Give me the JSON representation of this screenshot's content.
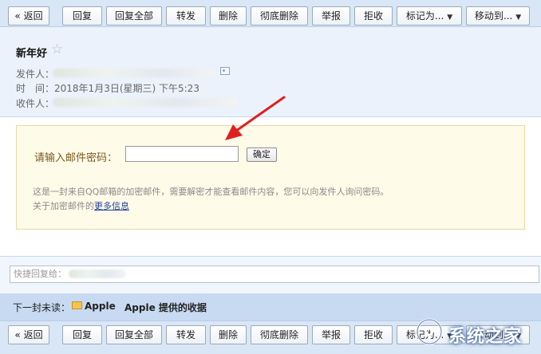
{
  "toolbar": {
    "back": "« 返回",
    "reply": "回复",
    "reply_all": "回复全部",
    "forward": "转发",
    "delete": "删除",
    "delete_permanent": "彻底删除",
    "report": "举报",
    "reject": "拒收",
    "mark_as": "标记为...",
    "move_to": "移动到..."
  },
  "email": {
    "subject": "新年好",
    "from_label": "发件人：",
    "time_label": "时　间：",
    "time_value": "2018年1月3日(星期三) 下午5:23",
    "to_label": "收件人："
  },
  "password_panel": {
    "prompt": "请输入邮件密码：",
    "confirm_button": "确定",
    "hint_line1": "这是一封来自QQ邮箱的加密邮件，需要解密才能查看邮件内容，您可以向发件人询问密码。",
    "hint_line2_prefix": "关于加密邮件的",
    "more_info_link": "更多信息"
  },
  "quick_reply": {
    "label": "快捷回复给："
  },
  "next_unread": {
    "label": "下一封未读：",
    "sender": "Apple",
    "subject": "Apple 提供的收据"
  },
  "colors": {
    "toolbar_bg": "#d9e6f5",
    "header_bg": "#ebf2fb",
    "panel_bg": "#fffbe9",
    "next_bar_bg": "#c7daf2",
    "arrow": "#e02020"
  },
  "icons": {
    "star": "star-icon",
    "contact": "contact-card-icon",
    "envelope": "envelope-icon",
    "dropdown": "chevron-down-icon"
  }
}
